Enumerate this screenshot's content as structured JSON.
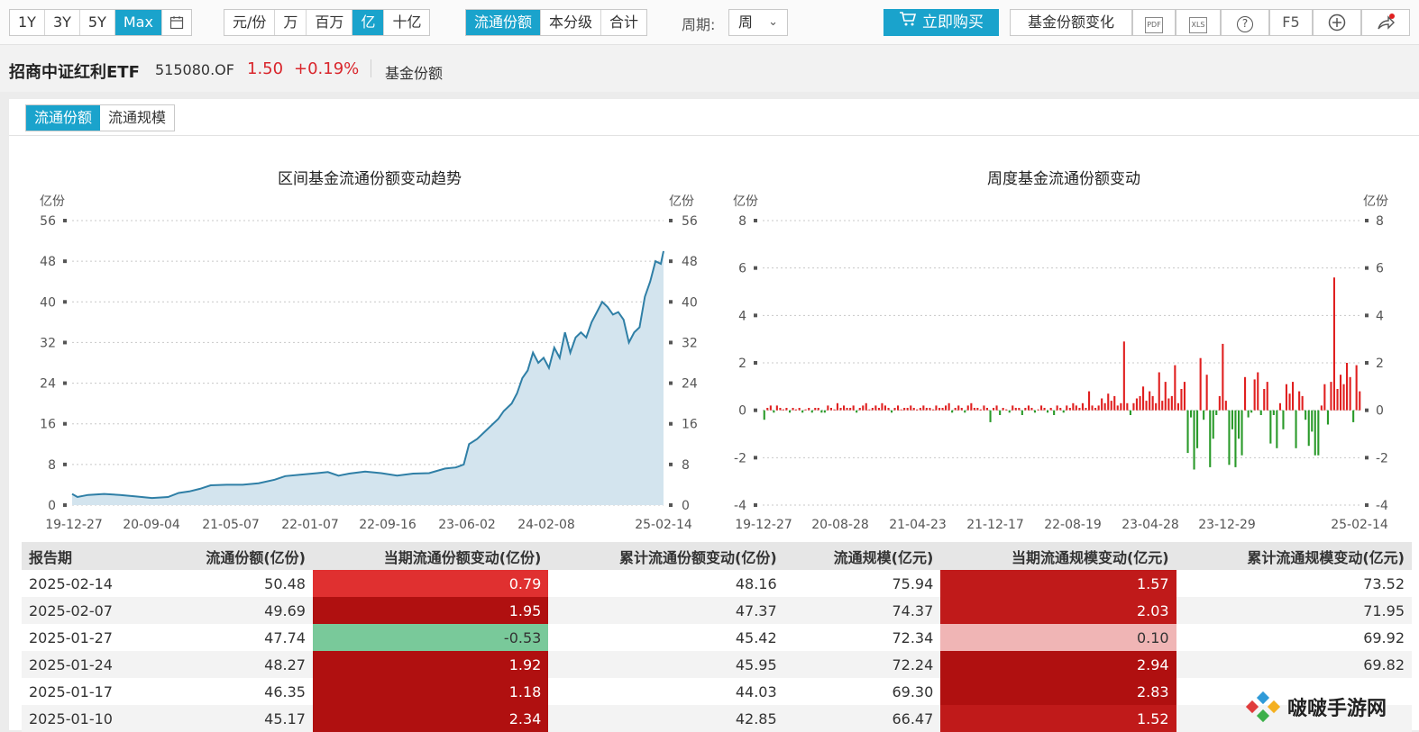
{
  "toolbar": {
    "range_tabs": [
      "1Y",
      "3Y",
      "5Y",
      "Max"
    ],
    "range_active": "Max",
    "unit_tabs": [
      "元/份",
      "万",
      "百万",
      "亿",
      "十亿"
    ],
    "unit_active": "亿",
    "mode_tabs": [
      "流通份额",
      "本分级",
      "合计"
    ],
    "mode_active": "流通份额",
    "period_label": "周期:",
    "period_value": "周",
    "buy_label": "立即购买",
    "share_change_label": "基金份额变化",
    "pdf_label": "PDF",
    "xls_label": "XLS",
    "help_label": "?",
    "f5_label": "F5"
  },
  "fund": {
    "name": "招商中证红利ETF",
    "code": "515080.OF",
    "price": "1.50",
    "change": "+0.19%",
    "section": "基金份额"
  },
  "subtabs": [
    "流通份额",
    "流通规模"
  ],
  "subtab_active": "流通份额",
  "chart_data": [
    {
      "type": "area",
      "title": "区间基金流通份额变动趋势",
      "ylabel_left": "亿份",
      "ylabel_right": "亿份",
      "ylim": [
        0,
        56
      ],
      "yticks": [
        0,
        8,
        16,
        24,
        32,
        40,
        48,
        56
      ],
      "xticks": [
        "19-12-27",
        "20-09-04",
        "21-05-07",
        "22-01-07",
        "22-09-16",
        "23-06-02",
        "24-02-08",
        "25-02-14"
      ],
      "x_fraction_label_note": "",
      "points": [
        [
          0.0,
          2.2
        ],
        [
          0.01,
          1.6
        ],
        [
          0.03,
          2.0
        ],
        [
          0.06,
          2.2
        ],
        [
          0.09,
          2.0
        ],
        [
          0.12,
          1.7
        ],
        [
          0.15,
          1.4
        ],
        [
          0.18,
          1.6
        ],
        [
          0.2,
          2.4
        ],
        [
          0.22,
          2.7
        ],
        [
          0.24,
          3.2
        ],
        [
          0.26,
          3.9
        ],
        [
          0.29,
          4.0
        ],
        [
          0.32,
          4.0
        ],
        [
          0.35,
          4.3
        ],
        [
          0.38,
          5.0
        ],
        [
          0.4,
          5.7
        ],
        [
          0.43,
          6.0
        ],
        [
          0.46,
          6.3
        ],
        [
          0.48,
          6.5
        ],
        [
          0.5,
          5.8
        ],
        [
          0.52,
          6.2
        ],
        [
          0.55,
          6.6
        ],
        [
          0.58,
          6.3
        ],
        [
          0.61,
          5.8
        ],
        [
          0.64,
          6.2
        ],
        [
          0.67,
          6.3
        ],
        [
          0.7,
          7.2
        ],
        [
          0.72,
          7.4
        ],
        [
          0.735,
          8.0
        ],
        [
          0.745,
          12.0
        ],
        [
          0.76,
          13.0
        ],
        [
          0.78,
          15.0
        ],
        [
          0.8,
          17.0
        ],
        [
          0.81,
          18.5
        ],
        [
          0.825,
          20.0
        ],
        [
          0.835,
          22.0
        ],
        [
          0.845,
          25.0
        ],
        [
          0.855,
          26.5
        ],
        [
          0.865,
          30.0
        ],
        [
          0.875,
          28.0
        ],
        [
          0.885,
          29.0
        ],
        [
          0.895,
          27.0
        ],
        [
          0.905,
          31.0
        ],
        [
          0.915,
          29.0
        ],
        [
          0.925,
          34.0
        ],
        [
          0.935,
          30.0
        ],
        [
          0.945,
          33.0
        ],
        [
          0.955,
          34.0
        ],
        [
          0.965,
          33.0
        ],
        [
          0.975,
          36.0
        ],
        [
          0.985,
          38.0
        ],
        [
          0.995,
          40.0
        ],
        [
          1.005,
          39.0
        ],
        [
          1.015,
          37.5
        ],
        [
          1.025,
          38.0
        ],
        [
          1.035,
          36.5
        ],
        [
          1.045,
          32.0
        ],
        [
          1.055,
          34.0
        ],
        [
          1.065,
          35.0
        ],
        [
          1.075,
          41.0
        ],
        [
          1.085,
          44.0
        ],
        [
          1.095,
          48.0
        ],
        [
          1.105,
          47.5
        ],
        [
          1.11,
          50.0
        ]
      ]
    },
    {
      "type": "bar",
      "title": "周度基金流通份额变动",
      "ylabel_left": "亿份",
      "ylabel_right": "亿份",
      "ylim": [
        -4,
        8
      ],
      "yticks": [
        -4,
        -2,
        0,
        2,
        4,
        6,
        8
      ],
      "xticks": [
        "19-12-27",
        "20-08-28",
        "21-04-23",
        "21-12-17",
        "22-08-19",
        "23-04-28",
        "23-12-29",
        "25-02-14"
      ],
      "bars": [
        -0.4,
        0.1,
        0.2,
        -0.1,
        0.2,
        0.1,
        0.0,
        0.1,
        -0.1,
        0.1,
        0.0,
        0.1,
        -0.1,
        0.0,
        0.1,
        -0.1,
        0.1,
        0.1,
        -0.1,
        -0.1,
        0.2,
        0.1,
        0.0,
        0.3,
        0.1,
        0.2,
        0.1,
        0.1,
        0.2,
        -0.1,
        0.1,
        0.2,
        0.3,
        0.0,
        0.1,
        0.2,
        0.1,
        0.3,
        0.2,
        0.1,
        -0.1,
        0.1,
        0.2,
        0.0,
        0.1,
        0.1,
        0.2,
        0.1,
        0.0,
        0.1,
        0.2,
        0.1,
        0.1,
        0.0,
        0.2,
        0.1,
        0.1,
        0.2,
        0.3,
        -0.1,
        0.1,
        0.2,
        0.1,
        -0.1,
        0.2,
        0.3,
        0.1,
        0.1,
        0.0,
        0.2,
        0.1,
        -0.5,
        0.1,
        0.2,
        -0.2,
        0.1,
        0.0,
        -0.1,
        0.2,
        0.1,
        0.1,
        -0.2,
        0.1,
        0.2,
        0.1,
        -0.1,
        0.0,
        0.2,
        0.1,
        -0.1,
        0.1,
        -0.2,
        0.2,
        0.1,
        -0.1,
        0.2,
        0.1,
        0.3,
        0.2,
        0.1,
        0.3,
        0.1,
        0.8,
        0.2,
        0.1,
        0.2,
        0.5,
        0.3,
        0.7,
        0.4,
        0.6,
        0.2,
        0.3,
        2.9,
        0.3,
        -0.2,
        0.3,
        0.5,
        0.6,
        1.0,
        0.4,
        0.8,
        0.6,
        0.3,
        1.6,
        0.4,
        1.2,
        0.5,
        0.6,
        1.9,
        0.3,
        0.9,
        1.2,
        -1.8,
        -0.3,
        -2.5,
        -1.6,
        2.2,
        -0.4,
        1.5,
        -2.4,
        -1.2,
        -0.2,
        0.6,
        2.8,
        0.4,
        -2.3,
        -0.8,
        -2.4,
        -1.2,
        -1.9,
        1.4,
        -0.3,
        -0.1,
        1.3,
        1.6,
        -0.2,
        0.9,
        1.2,
        -1.4,
        -0.2,
        -1.6,
        0.3,
        -0.8,
        1.1,
        0.7,
        1.2,
        -1.6,
        0.8,
        0.6,
        -0.4,
        -1.5,
        -0.9,
        -1.9,
        -1.9,
        0.2,
        1.1,
        -0.6,
        1.2,
        5.6,
        0.9,
        1.5,
        1.1,
        2.0,
        1.4,
        -0.5,
        1.9,
        0.8
      ]
    }
  ],
  "table": {
    "headers": [
      "报告期",
      "流通份额(亿份)",
      "当期流通份额变动(亿份)",
      "累计流通份额变动(亿份)",
      "流通规模(亿元)",
      "当期流通规模变动(亿元)",
      "累计流通规模变动(亿元)"
    ],
    "rows": [
      {
        "date": "2025-02-14",
        "shares": "50.48",
        "chg": "0.79",
        "cum": "48.16",
        "scale": "75.94",
        "scale_chg": "1.57",
        "scale_cum": "73.52",
        "chg_color": "#e03030",
        "scale_chg_color": "#c01a1a"
      },
      {
        "date": "2025-02-07",
        "shares": "49.69",
        "chg": "1.95",
        "cum": "47.37",
        "scale": "74.37",
        "scale_chg": "2.03",
        "scale_cum": "71.95",
        "chg_color": "#b01010",
        "scale_chg_color": "#c01a1a"
      },
      {
        "date": "2025-01-27",
        "shares": "47.74",
        "chg": "-0.53",
        "cum": "45.42",
        "scale": "72.34",
        "scale_chg": "0.10",
        "scale_cum": "69.92",
        "chg_color": "#79c99a",
        "scale_chg_color": "#f0b5b5"
      },
      {
        "date": "2025-01-24",
        "shares": "48.27",
        "chg": "1.92",
        "cum": "45.95",
        "scale": "72.24",
        "scale_chg": "2.94",
        "scale_cum": "69.82",
        "chg_color": "#b01010",
        "scale_chg_color": "#b01010"
      },
      {
        "date": "2025-01-17",
        "shares": "46.35",
        "chg": "1.18",
        "cum": "44.03",
        "scale": "69.30",
        "scale_chg": "2.83",
        "scale_cum": "",
        "chg_color": "#b01010",
        "scale_chg_color": "#b01010"
      },
      {
        "date": "2025-01-10",
        "shares": "45.17",
        "chg": "2.34",
        "cum": "42.85",
        "scale": "66.47",
        "scale_chg": "1.52",
        "scale_cum": "",
        "chg_color": "#b01010",
        "scale_chg_color": "#c01a1a"
      }
    ]
  },
  "watermark": {
    "text": "啵啵手游网"
  },
  "colors": {
    "accent": "#1aa3cc",
    "up": "#e02020",
    "down": "#2a9a2a",
    "line": "#2f7fa6",
    "area": "#d3e4ee"
  }
}
